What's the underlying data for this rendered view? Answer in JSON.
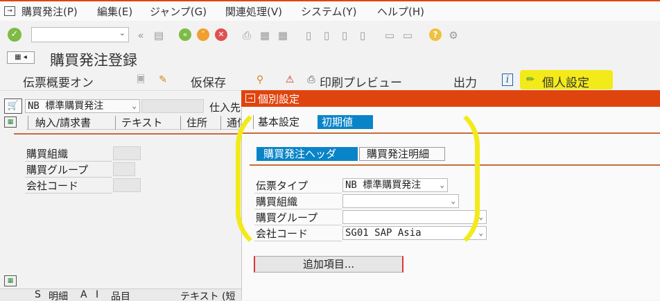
{
  "menu": [
    "購買発注(P)",
    "編集(E)",
    "ジャンプ(G)",
    "関連処理(V)",
    "システム(Y)",
    "ヘルプ(H)"
  ],
  "page_title": "購買発注登録",
  "app_toolbar": {
    "doc_overview": "伝票概要オン",
    "hold": "仮保存",
    "print_preview": "印刷プレビュー",
    "output": "出力",
    "personal_settings": "個人設定"
  },
  "header": {
    "doc_type_value": "NB 標準購買発注",
    "vendor_label": "仕入先",
    "tabs": [
      "納入/請求書",
      "テキスト",
      "住所",
      "通信"
    ]
  },
  "org_fields": {
    "purch_org": "購買組織",
    "purch_group": "購買グループ",
    "company_code": "会社コード"
  },
  "item_table_headers": [
    "S",
    "明細",
    "A",
    "I",
    "品目",
    "テキスト (短"
  ],
  "dialog": {
    "title": "個別設定",
    "tabs": [
      {
        "label": "基本設定",
        "active": false
      },
      {
        "label": "初期値",
        "active": true
      }
    ],
    "subtabs": [
      {
        "label": "購買発注ヘッダ",
        "active": true
      },
      {
        "label": "購買発注明細",
        "active": false
      }
    ],
    "fields": [
      {
        "label": "伝票タイプ",
        "value": "NB 標準購買発注"
      },
      {
        "label": "購買組織",
        "value": ""
      },
      {
        "label": "購買グループ",
        "value": ""
      },
      {
        "label": "会社コード",
        "value": "SG01 SAP Asia"
      }
    ],
    "more_button": "追加項目..."
  },
  "colors": {
    "sap_orange": "#e0440e",
    "active_tab_blue": "#0a84c8",
    "highlight_yellow": "#f3ea1a"
  }
}
